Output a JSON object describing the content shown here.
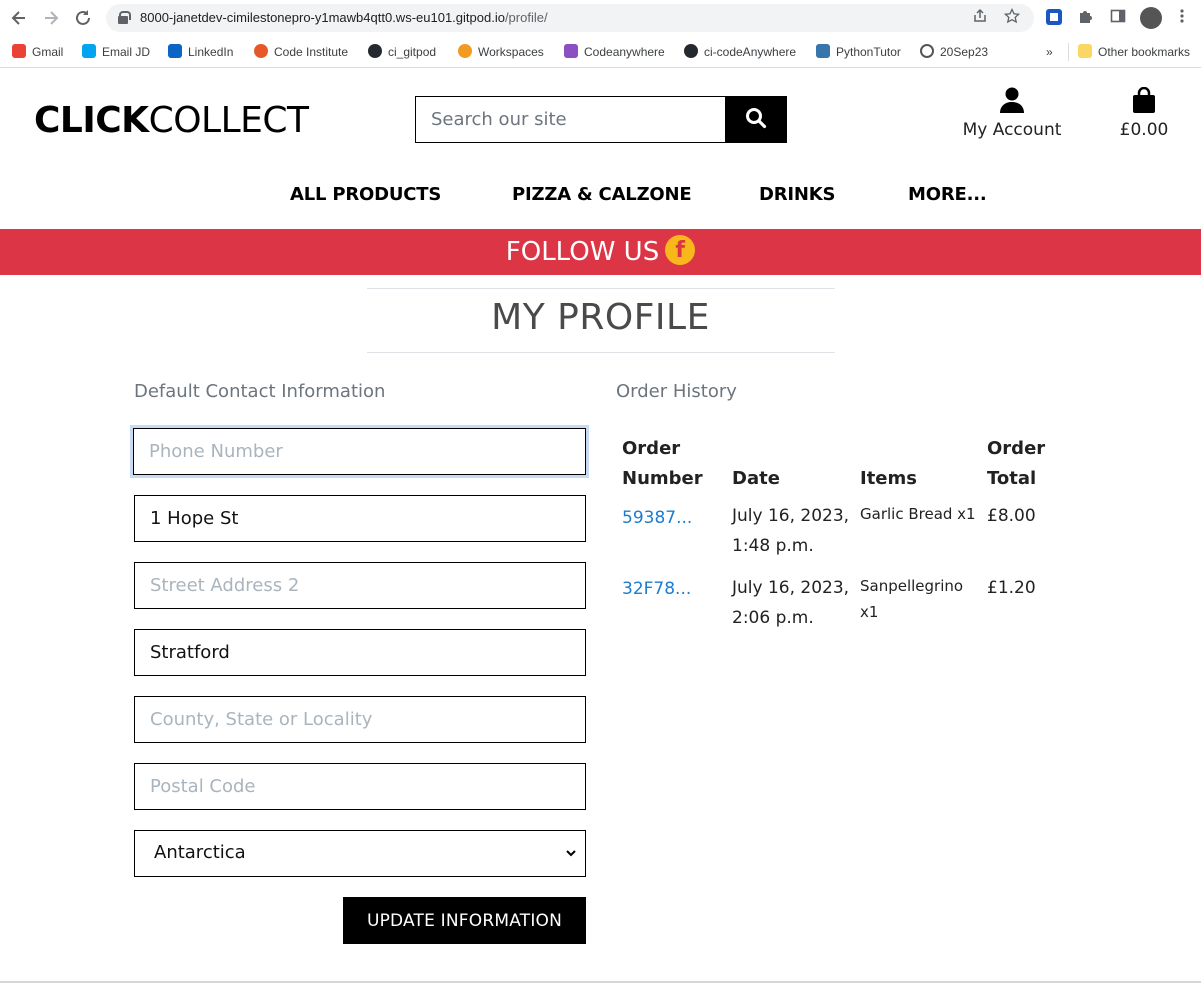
{
  "browser": {
    "url_host": "8000-janetdev-cimilestonepro-y1mawb4qtt0.ws-eu101.gitpod.io",
    "url_path": "/profile/",
    "bookmarks": [
      {
        "label": "Gmail",
        "color": "#ea4335"
      },
      {
        "label": "Email JD",
        "color": "#00a4ef"
      },
      {
        "label": "LinkedIn",
        "color": "#0a66c2"
      },
      {
        "label": "Code Institute",
        "color": "#e8572a"
      },
      {
        "label": "ci_gitpod",
        "color": "#24292f"
      },
      {
        "label": "Workspaces",
        "color": "#f29a22"
      },
      {
        "label": "Codeanywhere",
        "color": "#8a4fc2"
      },
      {
        "label": "ci-codeAnywhere",
        "color": "#24292f"
      },
      {
        "label": "PythonTutor",
        "color": "#3776ab"
      },
      {
        "label": "20Sep23",
        "color": "#555555"
      }
    ],
    "more_bookmarks": "»",
    "other_bookmarks": "Other bookmarks"
  },
  "header": {
    "logo_bold": "CLICK",
    "logo_light": "COLLECT",
    "search_placeholder": "Search our site",
    "account_label": "My Account",
    "bag_total": "£0.00"
  },
  "nav": {
    "items": [
      "ALL PRODUCTS",
      "PIZZA & CALZONE",
      "DRINKS",
      "MORE..."
    ]
  },
  "banner": {
    "text": "FOLLOW US",
    "color": "#dc3545"
  },
  "page": {
    "title": "MY PROFILE"
  },
  "contact": {
    "section_title": "Default Contact Information",
    "phone_placeholder": "Phone Number",
    "street1_value": "1 Hope St",
    "street2_placeholder": "Street Address 2",
    "town_value": "Stratford",
    "county_placeholder": "County, State or Locality",
    "postcode_placeholder": "Postal Code",
    "country_value": "Antarctica",
    "update_label": "UPDATE INFORMATION"
  },
  "orders": {
    "section_title": "Order History",
    "headers": {
      "number_1": "Order",
      "number_2": "Number",
      "date": "Date",
      "items": "Items",
      "total_1": "Order",
      "total_2": "Total"
    },
    "rows": [
      {
        "number": "59387...",
        "date_1": "July 16, 2023,",
        "date_2": "1:48 p.m.",
        "items_1": "Garlic Bread x1",
        "items_2": "",
        "total": "£8.00"
      },
      {
        "number": "32F78...",
        "date_1": "July 16, 2023,",
        "date_2": "2:06 p.m.",
        "items_1": "Sanpellegrino",
        "items_2": "x1",
        "total": "£1.20"
      }
    ]
  }
}
